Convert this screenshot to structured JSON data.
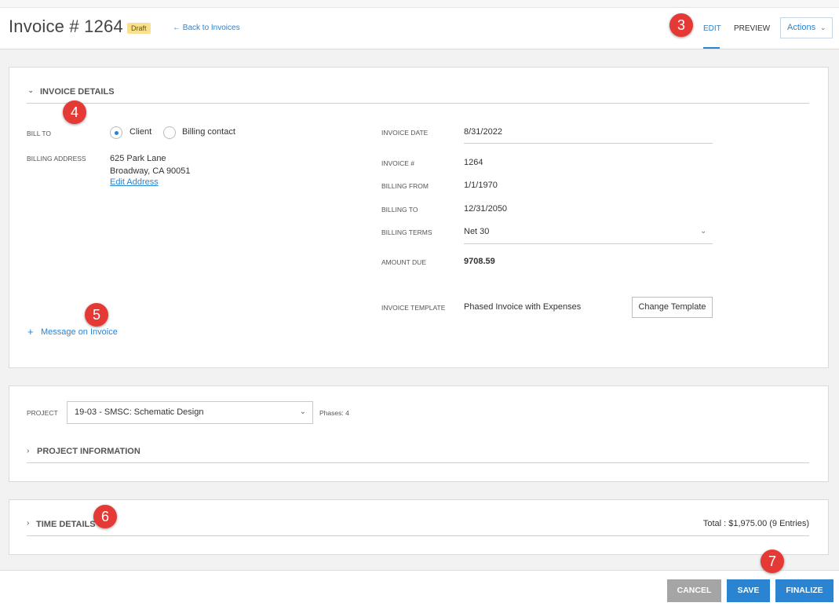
{
  "header": {
    "title": "Invoice # 1264",
    "status_badge": "Draft",
    "back_link": "← Back to Invoices",
    "tabs": [
      {
        "label": "EDIT",
        "active": true
      },
      {
        "label": "PREVIEW",
        "active": false
      }
    ],
    "actions_label": "Actions"
  },
  "markers": [
    "3",
    "4",
    "5",
    "6",
    "7"
  ],
  "invoice_details": {
    "section_title": "INVOICE DETAILS",
    "bill_to_label": "BILL TO",
    "bill_to_options": [
      {
        "label": "Client",
        "selected": true
      },
      {
        "label": "Billing contact",
        "selected": false
      }
    ],
    "billing_address_label": "BILLING ADDRESS",
    "address_line1": "625 Park Lane",
    "address_line2": "Broadway, CA 90051",
    "edit_address_link": "Edit Address",
    "message_link": "Message on Invoice",
    "invoice_date_label": "INVOICE DATE",
    "invoice_date": "8/31/2022",
    "invoice_number_label": "INVOICE #",
    "invoice_number": "1264",
    "billing_from_label": "BILLING FROM",
    "billing_from": "1/1/1970",
    "billing_to_label": "BILLING TO",
    "billing_to": "12/31/2050",
    "billing_terms_label": "BILLING TERMS",
    "billing_terms": "Net 30",
    "amount_due_label": "AMOUNT DUE",
    "amount_due": "9708.59",
    "template_label": "INVOICE TEMPLATE",
    "template_value": "Phased Invoice with Expenses",
    "change_template_button": "Change Template"
  },
  "project": {
    "label": "PROJECT",
    "selected": "19-03 - SMSC: Schematic Design",
    "phases": "Phases: 4",
    "info_title": "PROJECT INFORMATION"
  },
  "time_details": {
    "title": "TIME DETAILS",
    "total": "Total : $1,975.00 (9 Entries)"
  },
  "footer": {
    "cancel": "CANCEL",
    "save": "SAVE",
    "finalize": "FINALIZE"
  },
  "colors": {
    "accent": "#2a84d2",
    "badge": "#f8e08e",
    "marker": "#e53935",
    "cancel": "#a5a5a5"
  }
}
